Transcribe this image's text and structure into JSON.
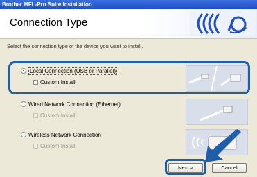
{
  "window": {
    "title": "Brother MFL-Pro Suite Installation"
  },
  "header": {
    "title": "Connection Type"
  },
  "instruction": "Select the connection type of the device you want to install.",
  "options": [
    {
      "label": "Local Connection (USB or Parallel)",
      "selected": true,
      "custom_install": {
        "label": "Custom Install",
        "enabled": true
      }
    },
    {
      "label": "Wired Network Connection (Ethernet)",
      "selected": false,
      "custom_install": {
        "label": "Custom Install",
        "enabled": false
      }
    },
    {
      "label": "Wireless Network Connection",
      "selected": false,
      "custom_install": {
        "label": "Custom Install",
        "enabled": false
      }
    }
  ],
  "buttons": {
    "next": "Next >",
    "cancel": "Cancel"
  },
  "colors": {
    "title_bar": "#1f4fc4",
    "highlight": "#1f5ea8",
    "dialog_bg": "#ece9d8"
  }
}
